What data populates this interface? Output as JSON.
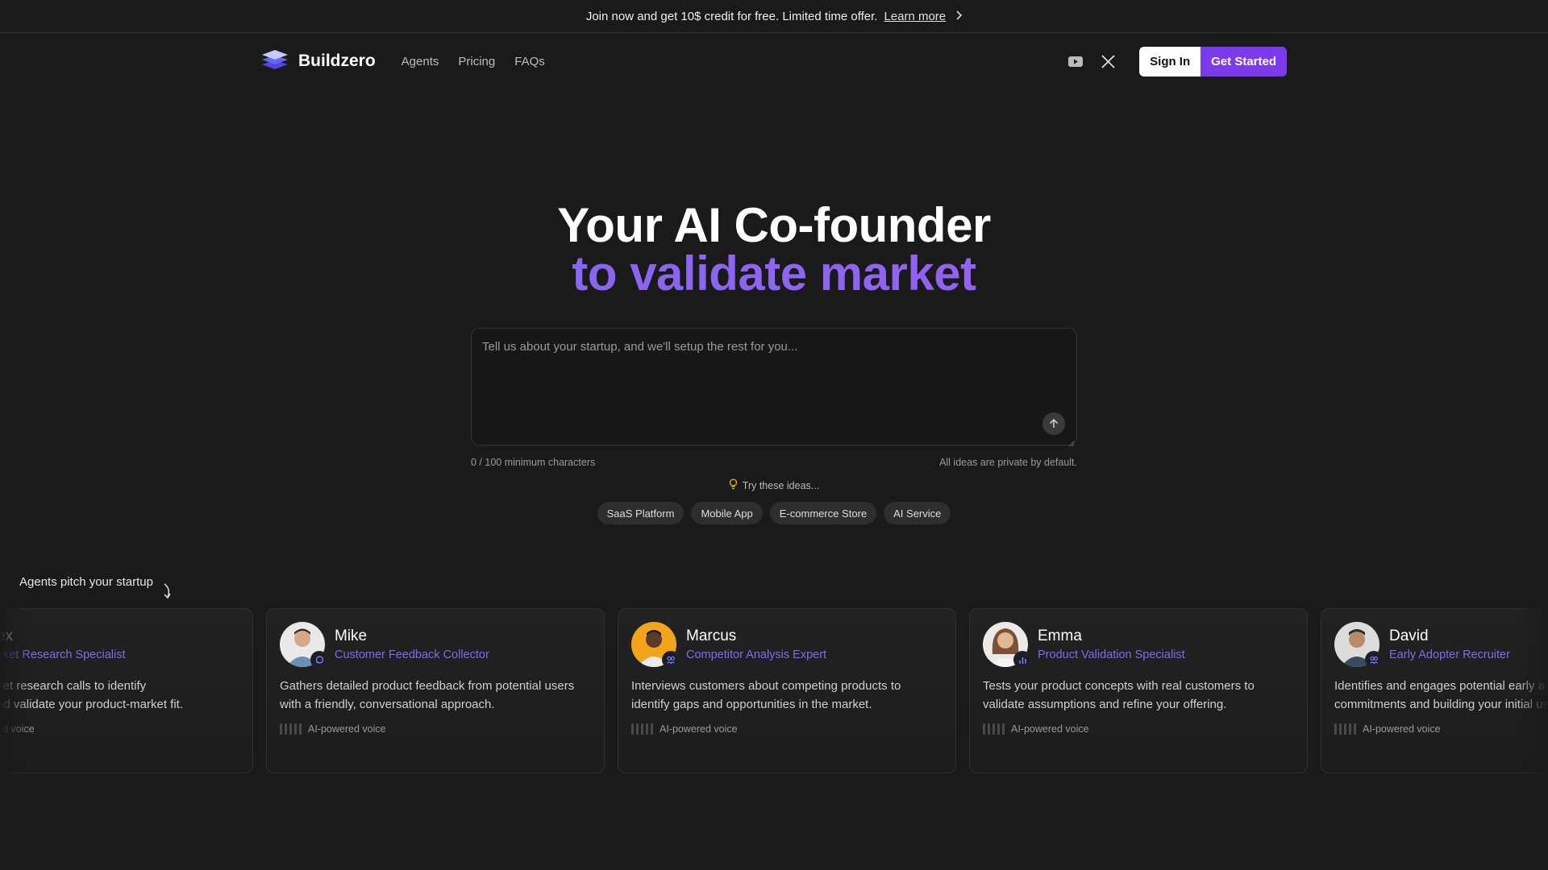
{
  "banner": {
    "text": "Join now and get 10$ credit for free. Limited time offer.",
    "link": "Learn more"
  },
  "nav": {
    "brand": "Buildzero",
    "links": [
      "Agents",
      "Pricing",
      "FAQs"
    ],
    "sign_in": "Sign In",
    "get_started": "Get Started",
    "icons": [
      "youtube-icon",
      "x-icon"
    ]
  },
  "hero": {
    "title_line1": "Your AI Co-founder",
    "title_line2": "to validate market"
  },
  "prompt": {
    "placeholder": "Tell us about your startup, and we'll setup the rest for you...",
    "char_count": "0 / 100 minimum characters",
    "privacy": "All ideas are private by default."
  },
  "ideas": {
    "label": "Try these ideas...",
    "chips": [
      "SaaS Platform",
      "Mobile App",
      "E-commerce Store",
      "AI Service"
    ]
  },
  "agents": {
    "section_label": "Agents pitch your startup",
    "voice_label": "AI-powered voice",
    "cards": [
      {
        "name": "Alex",
        "role": "Market Research Specialist",
        "desc_line1": "In-depth market research calls to identify",
        "desc_line2": "pain points and validate your product-market fit."
      },
      {
        "name": "Mike",
        "role": "Customer Feedback Collector",
        "desc_line1": "Gathers detailed product feedback from potential users",
        "desc_line2": "with a friendly, conversational approach."
      },
      {
        "name": "Marcus",
        "role": "Competitor Analysis Expert",
        "desc_line1": "Interviews customers about competing products to",
        "desc_line2": "identify gaps and opportunities in the market."
      },
      {
        "name": "Emma",
        "role": "Product Validation Specialist",
        "desc_line1": "Tests your product concepts with real customers to",
        "desc_line2": "validate assumptions and refine your offering."
      },
      {
        "name": "David",
        "role": "Early Adopter Recruiter",
        "desc_line1": "Identifies and engages potential early adopters, securing",
        "desc_line2": "commitments and building your initial user base."
      }
    ]
  },
  "colors": {
    "background": "#1a1a1a",
    "accent": "#7c3aed",
    "role_text": "#7b6cf3"
  }
}
